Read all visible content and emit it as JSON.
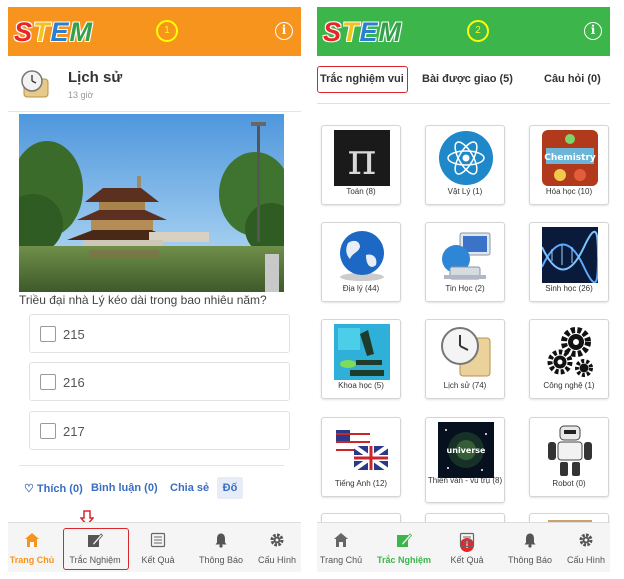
{
  "left_screen": {
    "marker": "1",
    "post": {
      "title": "Lịch sử",
      "time": "13 giờ",
      "question": "Triều đại nhà Lý kéo dài trong bao nhiêu năm?",
      "options": [
        "215",
        "216",
        "217"
      ],
      "actions": {
        "like": "♡ Thích (0)",
        "comment": "Bình luận (0)",
        "share": "Chia sẻ",
        "share_button": "Đố"
      }
    },
    "tabs": [
      "Trang Chủ",
      "Trắc Nghiệm",
      "Kết Quả",
      "Thông Báo",
      "Cấu Hình"
    ]
  },
  "right_screen": {
    "marker": "2",
    "top_tabs": [
      "Trắc nghiệm vui",
      "Bài được giao (5)",
      "Câu hỏi (0)"
    ],
    "subjects": [
      "Toán (8)",
      "Vật Lý (1)",
      "Hóa học (10)",
      "Địa lý (44)",
      "Tin Học (2)",
      "Sinh học (26)",
      "Khoa học (5)",
      "Lịch sử (74)",
      "Công nghệ (1)",
      "Tiếng Anh (12)",
      "Thiên văn - vũ trụ (8)",
      "Robot (0)"
    ],
    "badge": "!",
    "tabs": [
      "Trang Chủ",
      "Trắc Nghiệm",
      "Kết Quả",
      "Thông Báo",
      "Cấu Hình"
    ]
  },
  "icons": {
    "info": "i",
    "logo": "STEM"
  },
  "colors": {
    "left_header": "#f7941d",
    "right_header": "#3cb54a",
    "highlight": "#d9262c",
    "link": "#3a6dbf"
  }
}
